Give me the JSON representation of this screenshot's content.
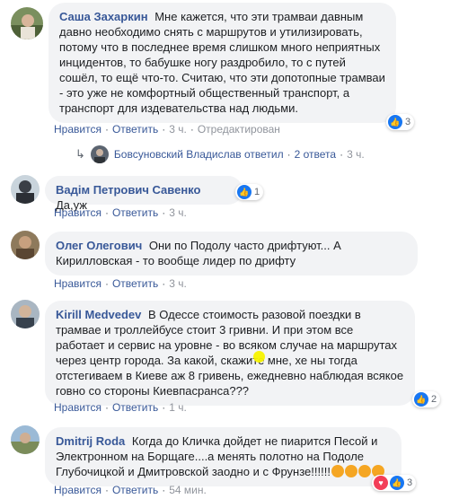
{
  "comments": [
    {
      "author": "Саша Захаркин",
      "text": "Мне кажется, что эти трамваи давным давно необходимо снять с маршрутов и утилизировать, потому что в последнее время слишком много неприятных инцидентов, то бабушке ногу раздробило, то с путей сошёл, то ещё что-то. Считаю, что эти допотопные трамваи - это уже не комфортный общественный транспорт, а транспорт для издевательства над людьми.",
      "like_label": "Нравится",
      "reply_label": "Ответить",
      "time": "3 ч.",
      "edited": "Отредактирован",
      "reactions": "3"
    },
    {
      "author": "Вадім Петрович Савенко",
      "text": "Да,уж",
      "like_label": "Нравится",
      "reply_label": "Ответить",
      "time": "3 ч.",
      "reactions": "1"
    },
    {
      "author": "Олег Олегович",
      "text": "Они по Подолу часто дрифтуют... А Кирилловская - то вообще лидер по дрифту",
      "like_label": "Нравится",
      "reply_label": "Ответить",
      "time": "3 ч."
    },
    {
      "author": "Kirill Medvedev",
      "text": "В Одессе стоимость разовой поездки в трамвае и троллейбусе стоит 3 гривни. И при этом все работает и сервис на уровне - во всяком случае на маршрутах через центр города. За какой, скажите мне, хе ны тогда отстегиваем в Киеве аж 8 гривень, ежедневно наблюдая всякое говно со стороны Киевпасранса???",
      "like_label": "Нравится",
      "reply_label": "Ответить",
      "time": "1 ч.",
      "reactions": "2"
    },
    {
      "author": "Dmitrij Roda",
      "text": "Когда до Кличка дойдет не пиарится Песой и Электронном на Борщаге....а менять полотно на Подоле Глубочицкой и Дмитровской заодно и с Фрунзе!!!!!!",
      "like_label": "Нравится",
      "reply_label": "Ответить",
      "time": "54 мин.",
      "reactions": "3"
    }
  ],
  "reply_summary": {
    "name": "Бовсуновский Владислав ответил",
    "count": "2 ответа",
    "time": "3 ч."
  },
  "colors": {
    "link": "#385898",
    "bubble": "#f2f3f5",
    "like": "#1877f2",
    "love": "#f33e58"
  }
}
